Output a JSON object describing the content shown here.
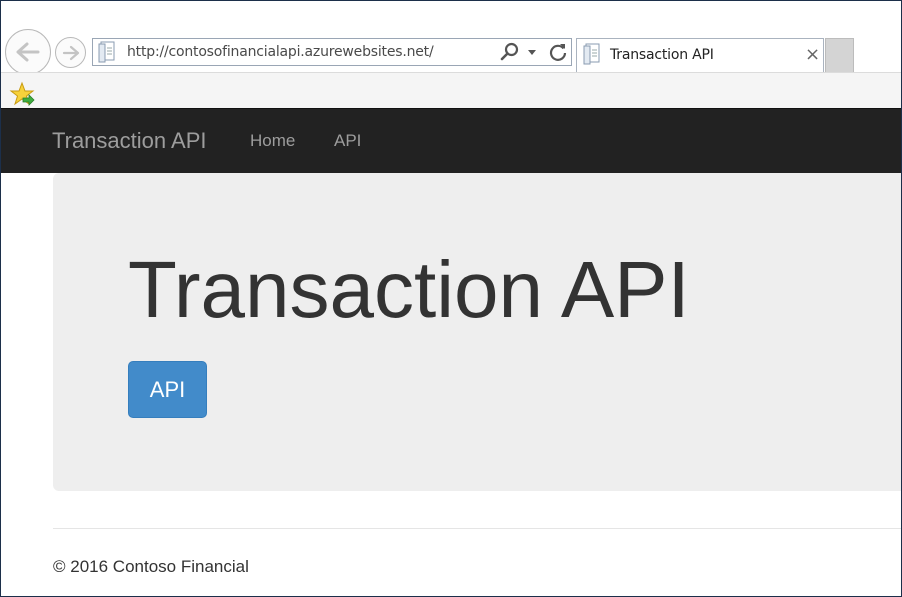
{
  "browser": {
    "url": "http://contosofinancialapi.azurewebsites.net/",
    "tab_title": "Transaction API",
    "tab_close": "×",
    "icons": {
      "back": "back-arrow-icon",
      "forward": "forward-arrow-icon",
      "page": "page-icon",
      "search": "search-icon",
      "dropdown": "chevron-down-icon",
      "refresh": "refresh-icon",
      "favorites": "favorites-star-icon"
    }
  },
  "site": {
    "brand": "Transaction API",
    "nav": {
      "home": "Home",
      "api": "API"
    },
    "jumbotron": {
      "title": "Transaction API",
      "button_label": "API"
    },
    "footer": "© 2016 Contoso Financial"
  },
  "colors": {
    "navbar": "#222222",
    "nav_text": "#9d9d9d",
    "jumbotron_bg": "#eeeeee",
    "primary_button": "#428bca"
  }
}
